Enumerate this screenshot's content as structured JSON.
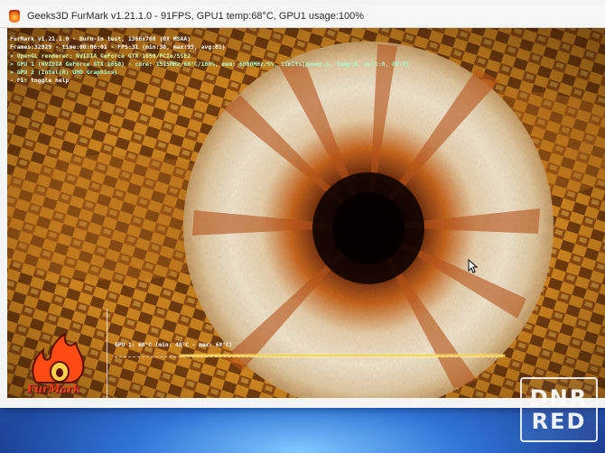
{
  "window": {
    "title": "Geeks3D FurMark v1.21.1.0 - 91FPS, GPU1 temp:68°C, GPU1 usage:100%"
  },
  "osd": {
    "lines": [
      "FurMark v1.21.1.0 - Burn-in test, 1366x768 (0X MSAA)",
      "Frames:32929 - time:00:06:01 - FPS:31 (min:30, max:95, avg:81)",
      "> OpenGL renderer: NVIDIA GeForce GTX 1650/PCIe/SSE2",
      "> GPU 1 (NVIDIA GeForce GTX 1650) - core: 1515MHz/68°C/100%, mem: 6000MHz/5%, limits[power:1, temp:0, volt:0, OV:0]",
      "> GPU 2 (Intel(R) UHD Graphics)",
      "- F1: toggle help"
    ]
  },
  "graph": {
    "label": "GPU 1: 68°C (min: 48°C - max: 68°C)"
  },
  "logo": {
    "text": "FurMark"
  },
  "watermark": {
    "line1": "DNR",
    "line2": "RED"
  },
  "colors": {
    "fur_light": "#f2e6cf",
    "fur_orange": "#c8661e",
    "background_gold": "#d79a2a",
    "graph_line": "#ffd640"
  }
}
